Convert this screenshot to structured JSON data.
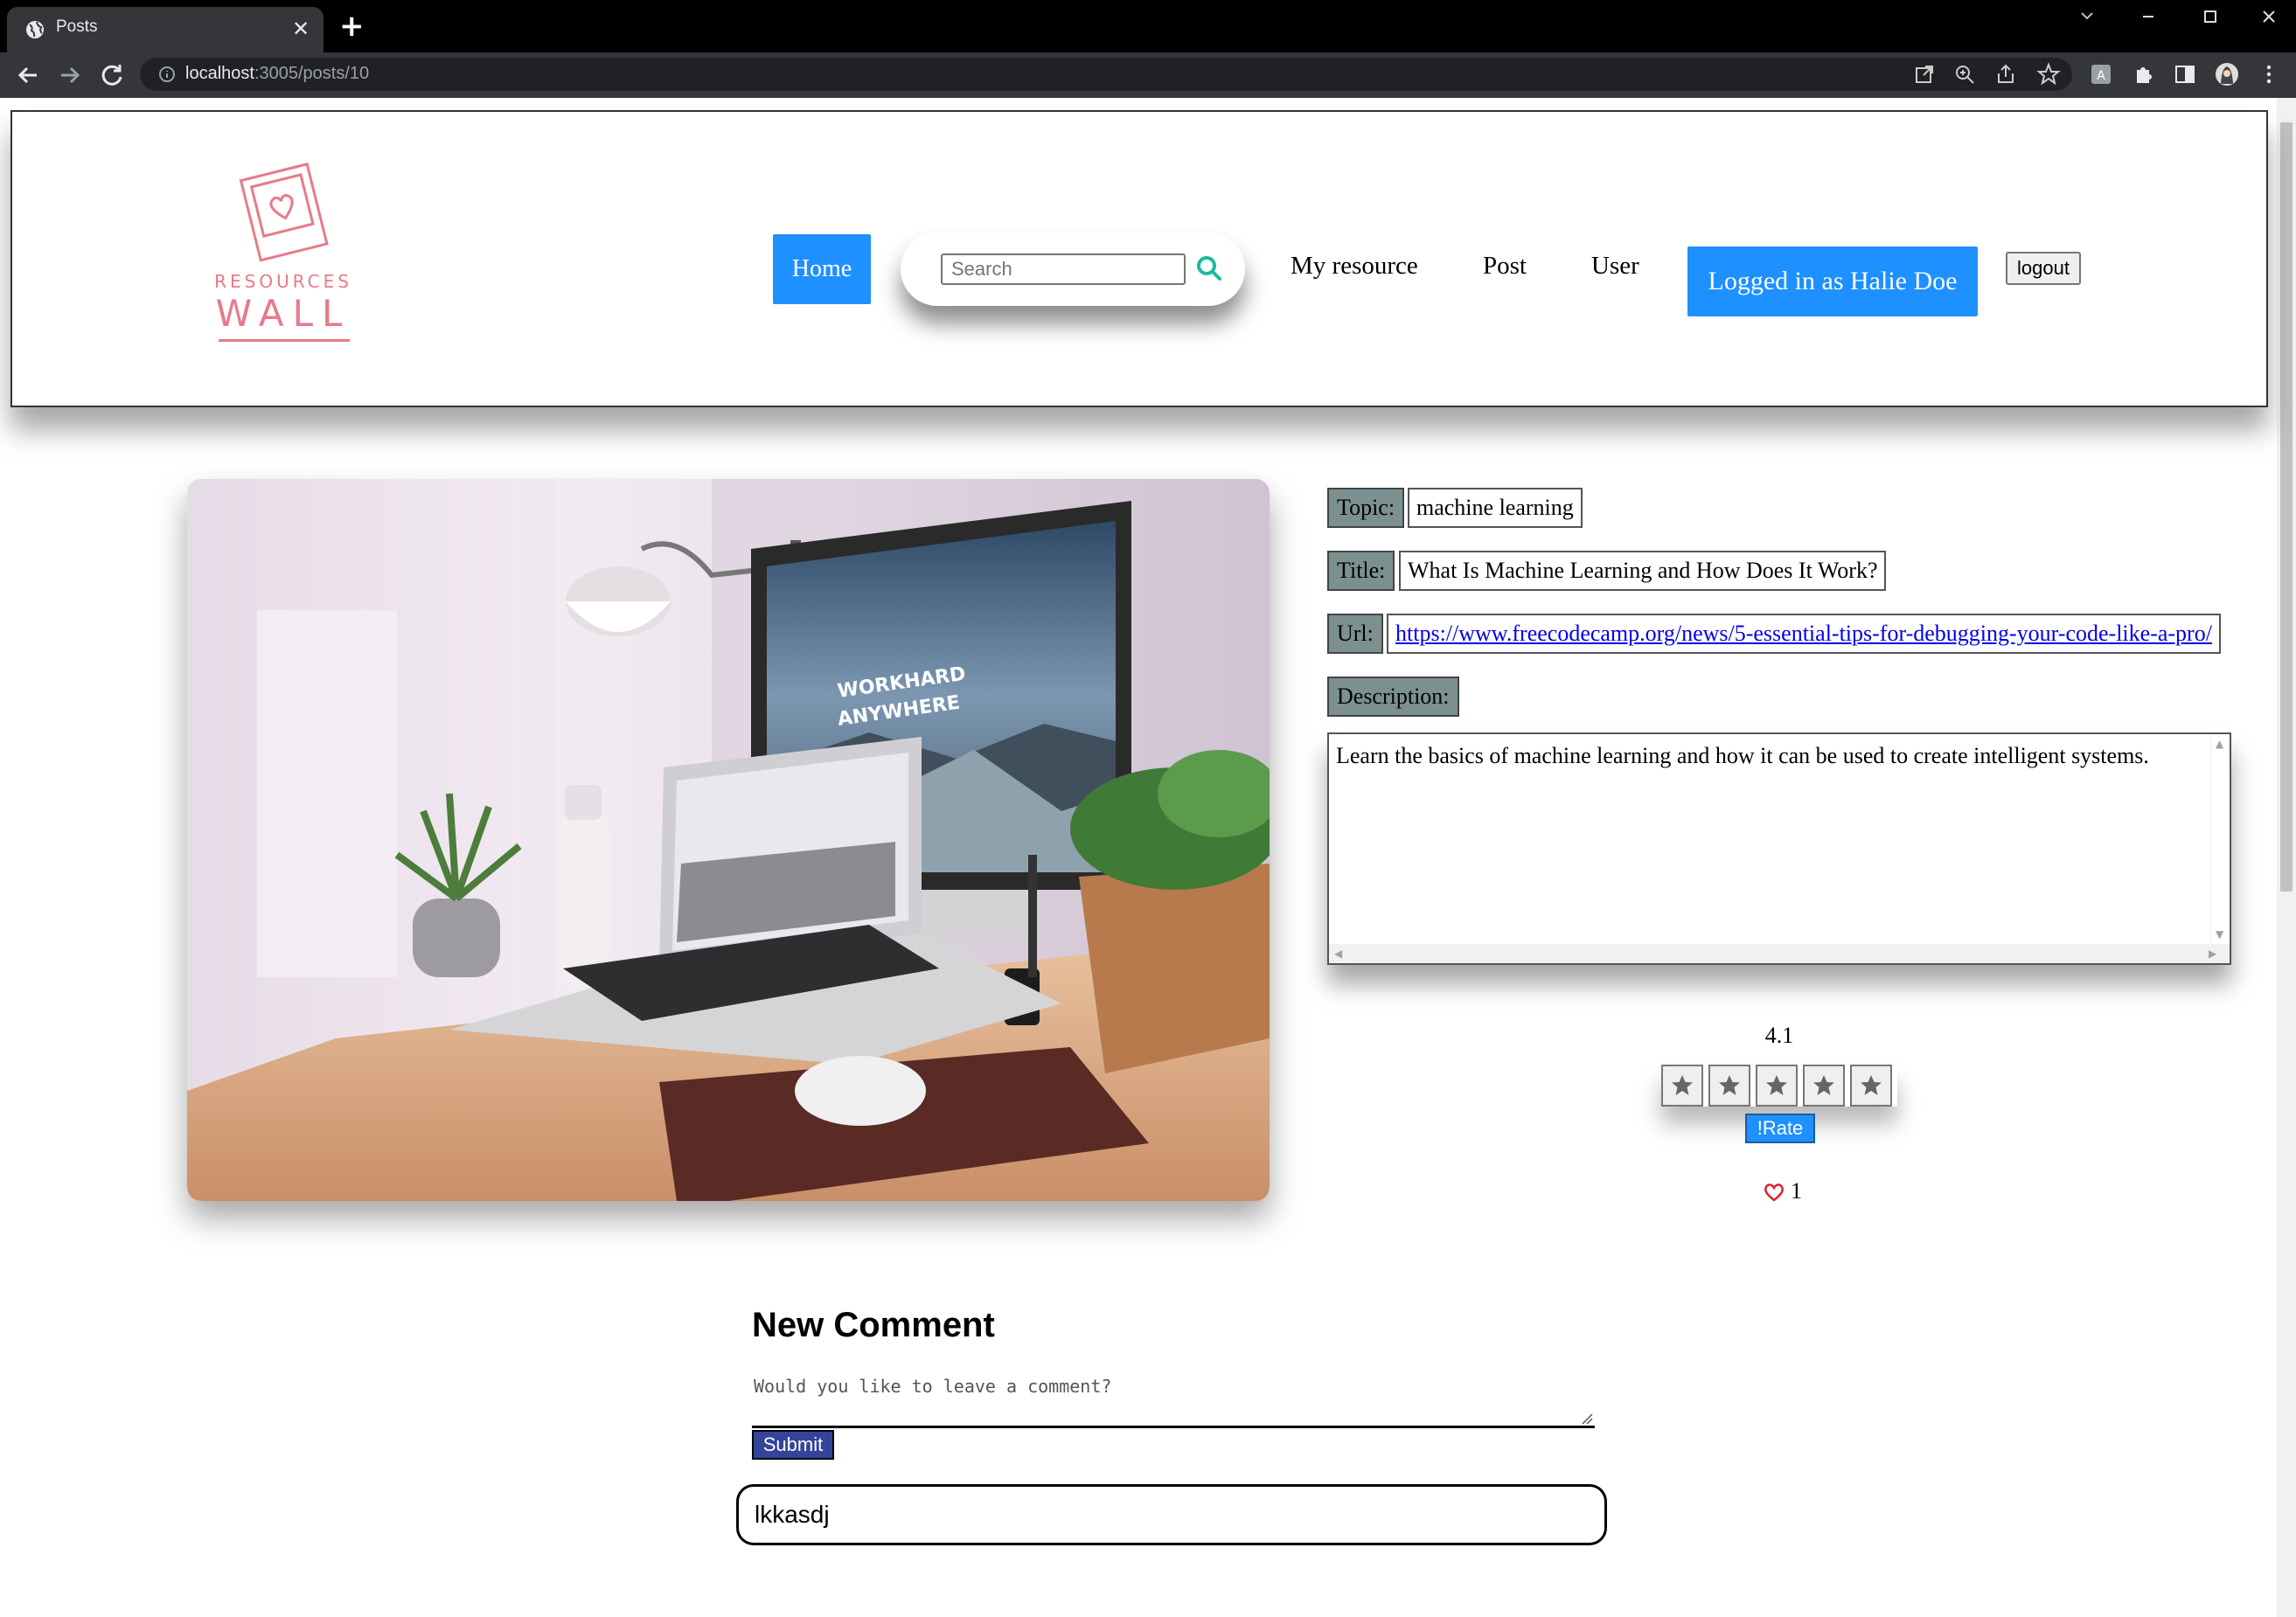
{
  "browser": {
    "tab_title": "Posts",
    "url_host": "localhost",
    "url_rest": ":3005/posts/10"
  },
  "header": {
    "logo_top": "RESOURCES",
    "logo_main": "WALL",
    "nav": {
      "home": "Home",
      "search_placeholder": "Search",
      "my_resource": "My resource",
      "post": "Post",
      "user": "User",
      "logged_in": "Logged in as Halie Doe",
      "logout": "logout"
    }
  },
  "post": {
    "topic_label": "Topic:",
    "topic": "machine learning",
    "title_label": "Title:",
    "title": "What Is Machine Learning and How Does It Work?",
    "url_label": "Url:",
    "url": "https://www.freecodecamp.org/news/5-essential-tips-for-debugging-your-code-like-a-pro/",
    "description_label": "Description:",
    "description": "Learn the basics of machine learning and how it can be used to create intelligent systems."
  },
  "rating": {
    "average": "4.1",
    "stars_max": 5,
    "rate_button": "!Rate",
    "likes": "1"
  },
  "comments": {
    "heading": "New Comment",
    "placeholder": "Would you like to leave a comment?",
    "submit": "Submit",
    "items": [
      "lkkasdj"
    ]
  },
  "colors": {
    "accent_blue": "#1e90ff",
    "label_bg": "#7c9090",
    "logo_pink": "#e87a8a",
    "submit_bg": "#34449a"
  }
}
